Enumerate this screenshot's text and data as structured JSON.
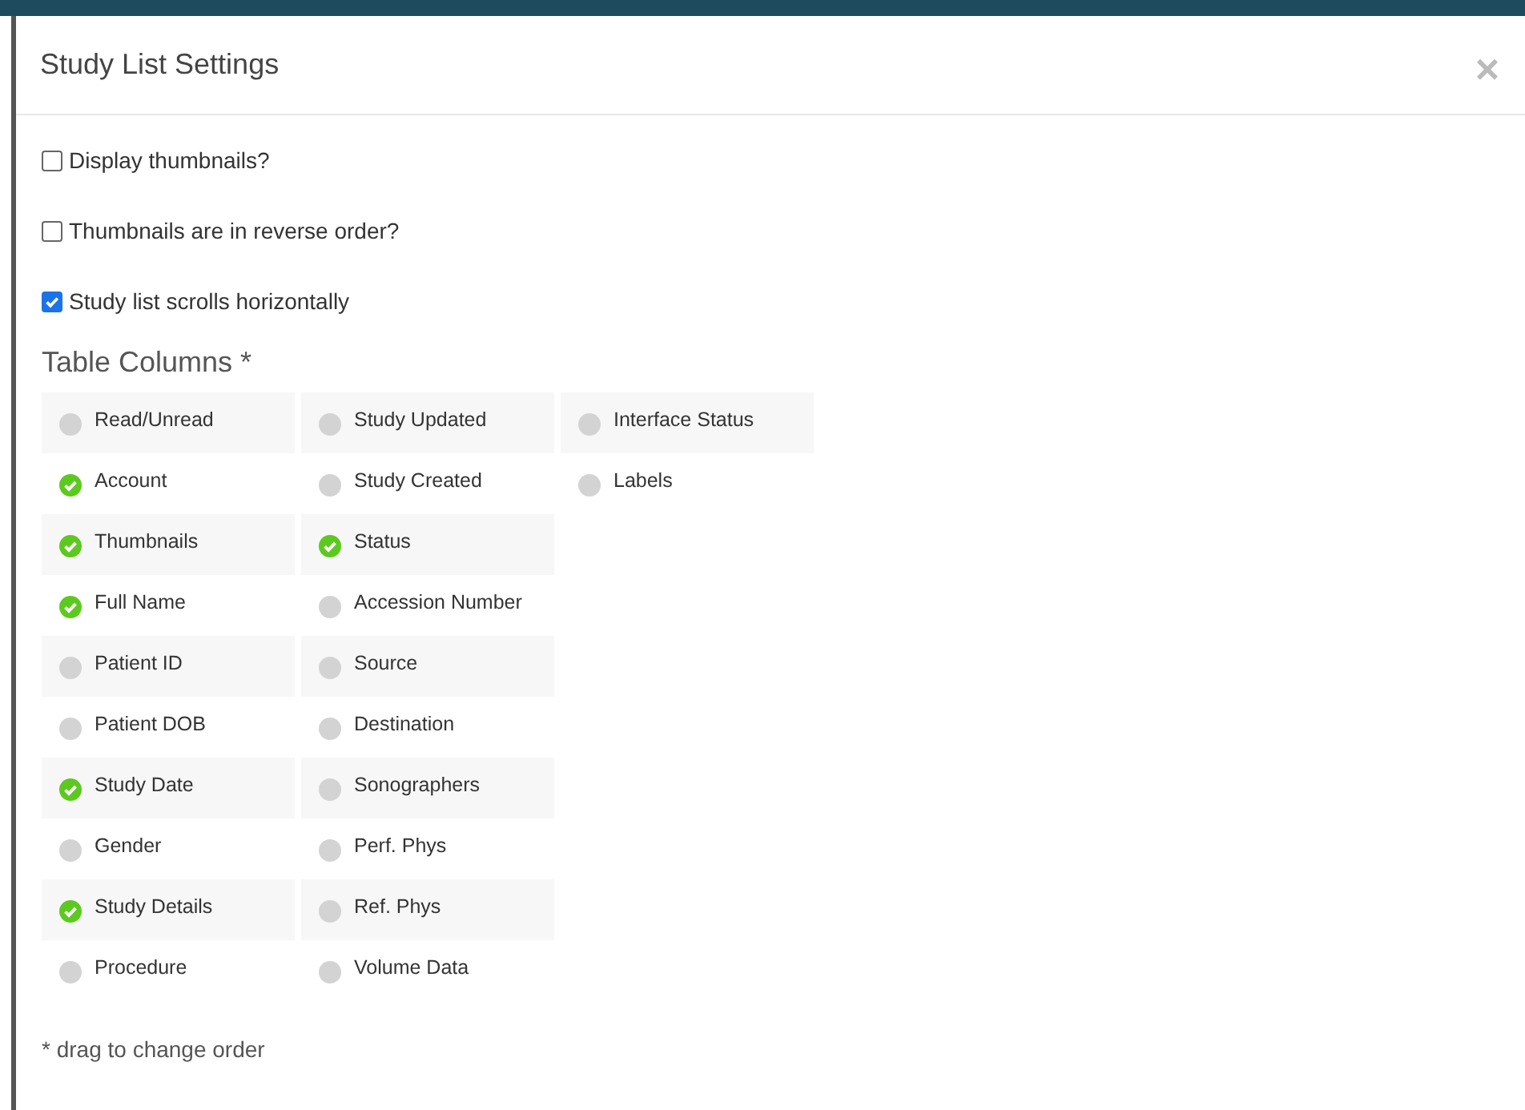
{
  "dialog": {
    "title": "Study List Settings",
    "close": "×"
  },
  "options": [
    {
      "label": "Display thumbnails?",
      "checked": false
    },
    {
      "label": "Thumbnails are in reverse order?",
      "checked": false
    },
    {
      "label": "Study list scrolls horizontally",
      "checked": true
    }
  ],
  "table_columns": {
    "heading": "Table Columns *",
    "columns": [
      [
        {
          "label": "Read/Unread",
          "checked": false
        },
        {
          "label": "Account",
          "checked": true
        },
        {
          "label": "Thumbnails",
          "checked": true
        },
        {
          "label": "Full Name",
          "checked": true
        },
        {
          "label": "Patient ID",
          "checked": false
        },
        {
          "label": "Patient DOB",
          "checked": false
        },
        {
          "label": "Study Date",
          "checked": true
        },
        {
          "label": "Gender",
          "checked": false
        },
        {
          "label": "Study Details",
          "checked": true
        },
        {
          "label": "Procedure",
          "checked": false
        }
      ],
      [
        {
          "label": "Study Updated",
          "checked": false
        },
        {
          "label": "Study Created",
          "checked": false
        },
        {
          "label": "Status",
          "checked": true
        },
        {
          "label": "Accession Number",
          "checked": false
        },
        {
          "label": "Source",
          "checked": false
        },
        {
          "label": "Destination",
          "checked": false
        },
        {
          "label": "Sonographers",
          "checked": false
        },
        {
          "label": "Perf. Phys",
          "checked": false
        },
        {
          "label": "Ref. Phys",
          "checked": false
        },
        {
          "label": "Volume Data",
          "checked": false
        }
      ],
      [
        {
          "label": "Interface Status",
          "checked": false
        },
        {
          "label": "Labels",
          "checked": false
        }
      ]
    ],
    "footnote": "* drag to change order"
  }
}
